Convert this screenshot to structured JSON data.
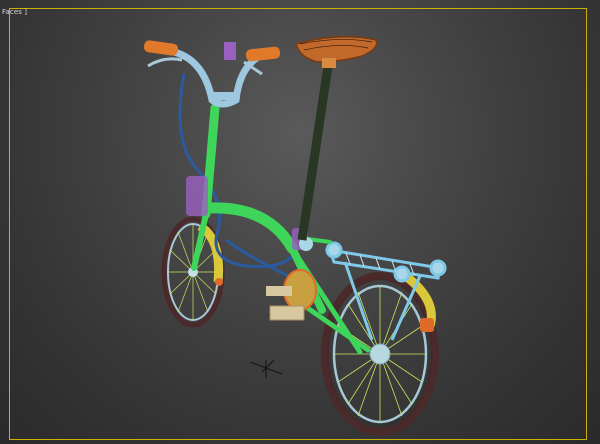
{
  "viewport": {
    "label": "Faces ]",
    "border_color": "#c8b400"
  },
  "scene": {
    "object": "folding-bicycle-wireframe",
    "colors": {
      "frame": "#3fd45a",
      "handlebar": "#9ec8e0",
      "grips": "#e07a2a",
      "saddle": "#c0692a",
      "seatpost": "#2a3a26",
      "tire": "#4a2a2a",
      "rim": "#a8c8d8",
      "spokes": "#c8e860",
      "fender": "#d8c83a",
      "cable": "#2a5aa0",
      "rack": "#7ec8e8",
      "accent": "#9a60c0"
    }
  }
}
